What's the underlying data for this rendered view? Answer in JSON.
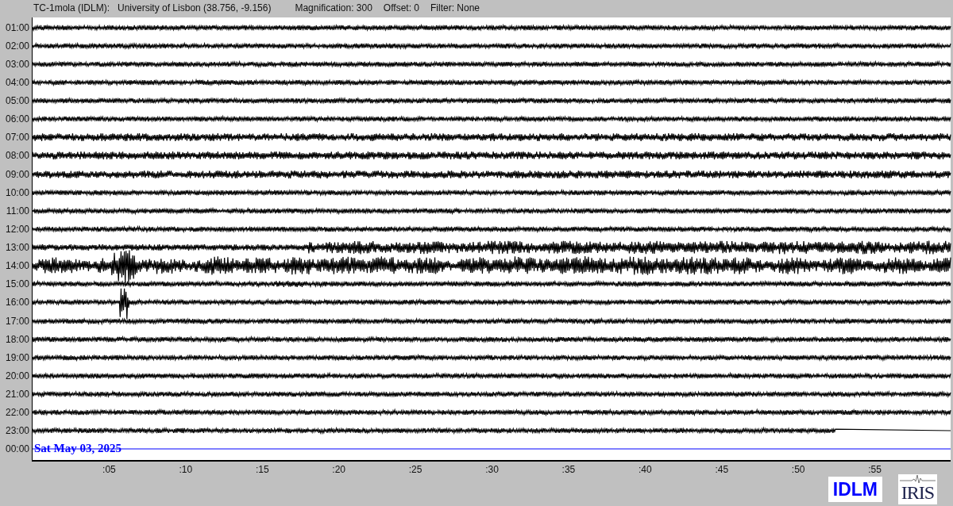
{
  "header": {
    "station": "TC-1mola (IDLM):",
    "location": "University of Lisbon (38.756, -9.156)",
    "magnification": "Magnification: 300",
    "offset": "Offset: 0",
    "filter": "Filter: None"
  },
  "rows": [
    {
      "label": "01:00",
      "kind": "full"
    },
    {
      "label": "02:00",
      "kind": "full"
    },
    {
      "label": "03:00",
      "kind": "full"
    },
    {
      "label": "04:00",
      "kind": "full"
    },
    {
      "label": "05:00",
      "kind": "full"
    },
    {
      "label": "06:00",
      "kind": "full"
    },
    {
      "label": "07:00",
      "kind": "full"
    },
    {
      "label": "08:00",
      "kind": "full"
    },
    {
      "label": "09:00",
      "kind": "full"
    },
    {
      "label": "10:00",
      "kind": "full"
    },
    {
      "label": "11:00",
      "kind": "full"
    },
    {
      "label": "12:00",
      "kind": "full"
    },
    {
      "label": "13:00",
      "kind": "full"
    },
    {
      "label": "14:00",
      "kind": "full"
    },
    {
      "label": "15:00",
      "kind": "full"
    },
    {
      "label": "16:00",
      "kind": "full"
    },
    {
      "label": "17:00",
      "kind": "full"
    },
    {
      "label": "18:00",
      "kind": "full"
    },
    {
      "label": "19:00",
      "kind": "full"
    },
    {
      "label": "20:00",
      "kind": "full"
    },
    {
      "label": "21:00",
      "kind": "full"
    },
    {
      "label": "22:00",
      "kind": "full"
    },
    {
      "label": "23:00",
      "kind": "partial"
    },
    {
      "label": "00:00",
      "kind": "current",
      "date": "Sat May 03, 2025"
    }
  ],
  "x_ticks": [
    ":05",
    ":10",
    ":15",
    ":20",
    ":25",
    ":30",
    ":35",
    ":40",
    ":45",
    ":50",
    ":55"
  ],
  "logos": {
    "network": "IDLM",
    "iris": "IRIS"
  }
}
